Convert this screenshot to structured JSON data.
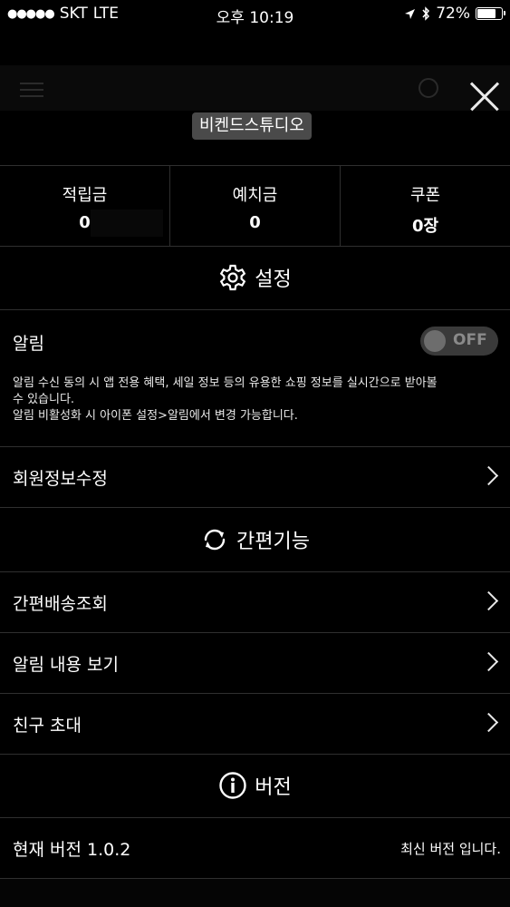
{
  "status_bar": {
    "signal": "●●●●●",
    "carrier": "SKT",
    "network": "LTE",
    "time": "오후 10:19",
    "battery": "72%"
  },
  "store_name": "비켄드스튜디오",
  "stats": [
    {
      "label": "적립금",
      "value": "0"
    },
    {
      "label": "예치금",
      "value": "0"
    },
    {
      "label": "쿠폰",
      "value": "0장"
    }
  ],
  "settings": {
    "title": "설정",
    "alarm_label": "알림",
    "toggle_state": "OFF",
    "alarm_desc_line1": "알림 수신 동의 시 앱 전용 혜택, 세일 정보 등의 유용한 쇼핑 정보를 실시간으로 받아볼",
    "alarm_desc_line2": "수 있습니다.",
    "alarm_desc_line3": "알림 비활성화 시 아이폰 설정>알림에서 변경 가능합니다.",
    "edit_profile": "회원정보수정"
  },
  "quick": {
    "title": "간편기능",
    "items": [
      "간편배송조회",
      "알림 내용 보기",
      "친구 초대"
    ]
  },
  "version": {
    "title": "버전",
    "current": "현재 버전 1.0.2",
    "status": "최신 버전 입니다."
  },
  "icons": [
    "gear-icon",
    "refresh-icon",
    "info-icon",
    "close-icon",
    "chevron-right-icon"
  ]
}
